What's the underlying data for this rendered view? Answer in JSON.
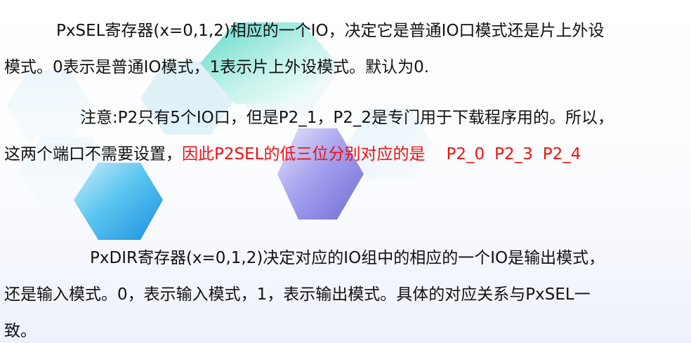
{
  "paragraph1": {
    "line1": "PxSEL寄存器(x=0,1,2)相应的一个IO，决定它是普通IO口模式还是片上外设",
    "line2": "模式。0表示是普通IO模式，1表示片上外设模式。默认为0."
  },
  "paragraph2": {
    "line1": "注意:P2只有5个IO口，但是P2_1，P2_2是专门用于下载程序用的。所以，",
    "line2_black": "这两个端口不需要设置，",
    "line2_red": "因此P2SEL的低三位分别对应的是",
    "pins": [
      "P2_0",
      "P2_3",
      "P2_4"
    ]
  },
  "paragraph3": {
    "line1": "PxDIR寄存器(x=0,1,2)决定对应的IO组中的相应的一个IO是输出模式，",
    "line2": "还是输入模式。0，表示输入模式，1，表示输出模式。具体的对应关系与PxSEL一",
    "line3": "致。"
  },
  "colors": {
    "text": "#111111",
    "highlight": "#f01010"
  }
}
